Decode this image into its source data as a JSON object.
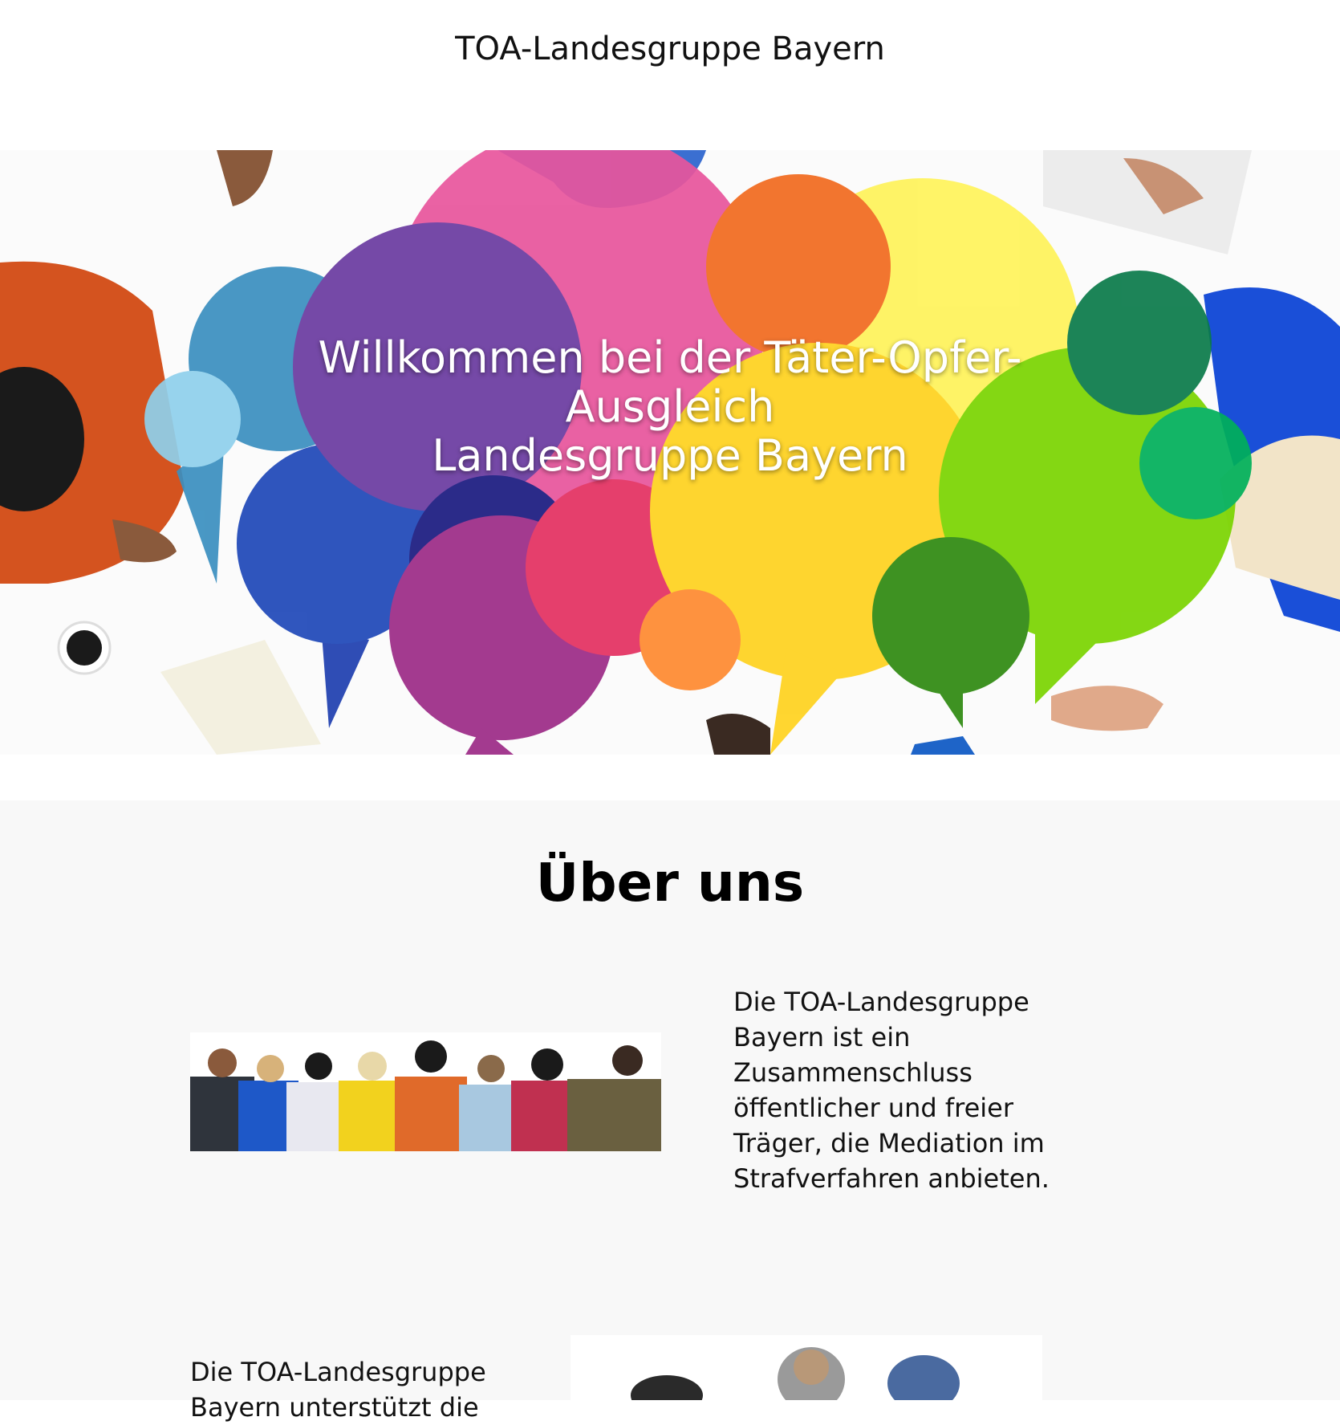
{
  "header": {
    "site_title": "TOA-Landesgruppe Bayern"
  },
  "hero": {
    "heading_line1": "Willkommen bei der Täter-Opfer-",
    "heading_line2": "Ausgleich",
    "heading_line3": "Landesgruppe Bayern"
  },
  "about": {
    "title": "Über uns",
    "paragraph_1": "Die TOA-Landesgruppe Bayern ist ein Zusammenschluss öffentlicher und freier Träger, die Mediation im Strafverfahren anbieten.",
    "paragraph_2": "Die TOA-Landesgruppe Bayern unterstützt die"
  }
}
